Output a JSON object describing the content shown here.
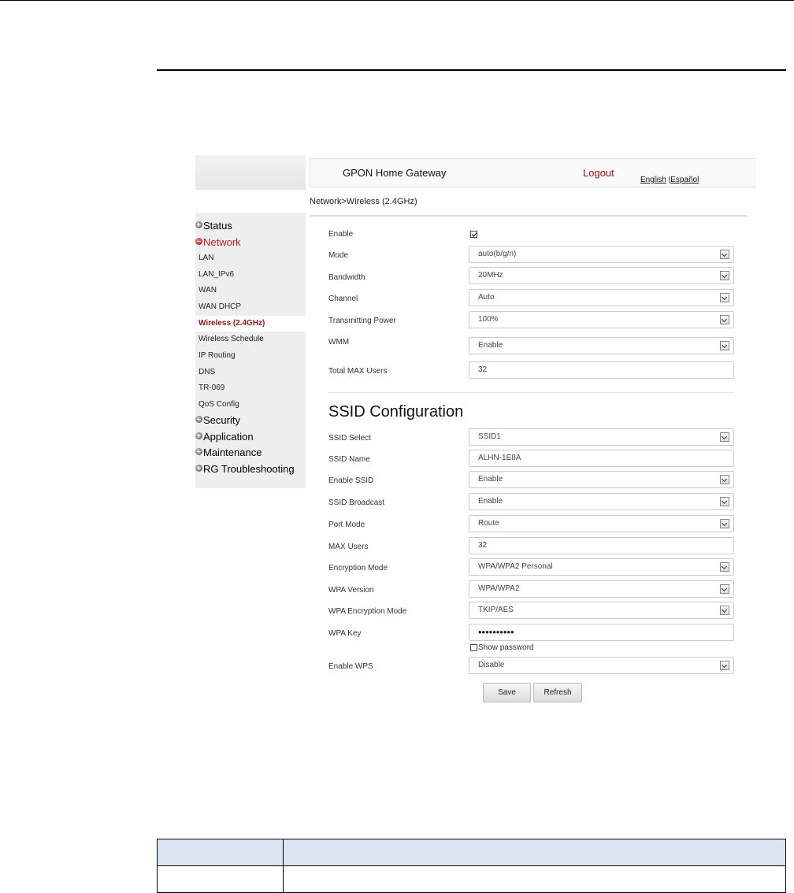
{
  "header": {
    "title": "GPON Home Gateway",
    "logout": "Logout",
    "lang_english": "English",
    "lang_separator": "|",
    "lang_spanish": "Español"
  },
  "breadcrumb": "Network>Wireless (2.4GHz)",
  "menu": {
    "groups": [
      "Status",
      "Network",
      "Security",
      "Application",
      "Maintenance",
      "RG Troubleshooting"
    ],
    "network_items": [
      "LAN",
      "LAN_IPv6",
      "WAN",
      "WAN DHCP",
      "Wireless (2.4GHz)",
      "Wireless Schedule",
      "IP Routing",
      "DNS",
      "TR-069",
      "QoS Config"
    ]
  },
  "wireless": {
    "enable_label": "Enable",
    "enable_checked": true,
    "mode_label": "Mode",
    "mode_value": "auto(b/g/n)",
    "bandwidth_label": "Bandwidth",
    "bandwidth_value": "20MHz",
    "channel_label": "Channel",
    "channel_value": "Auto",
    "power_label": "Transmitting Power",
    "power_value": "100%",
    "wmm_label": "WMM",
    "wmm_value": "Enable",
    "max_users_label": "Total MAX Users",
    "max_users_value": "32"
  },
  "ssid": {
    "section_title": "SSID Configuration",
    "select_label": "SSID Select",
    "select_value": "SSID1",
    "name_label": "SSID Name",
    "name_value": "ALHN-1E8A",
    "enable_label": "Enable SSID",
    "enable_value": "Enable",
    "broadcast_label": "SSID Broadcast",
    "broadcast_value": "Enable",
    "port_mode_label": "Port Mode",
    "port_mode_value": "Route",
    "max_users_label": "MAX Users",
    "max_users_value": "32",
    "encryption_label": "Encryption Mode",
    "encryption_value": "WPA/WPA2 Personal",
    "wpa_version_label": "WPA Version",
    "wpa_version_value": "WPA/WPA2",
    "wpa_enc_label": "WPA Encryption Mode",
    "wpa_enc_value": "TKIP/AES",
    "wpa_key_label": "WPA Key",
    "wpa_key_value": "••••••••••",
    "show_password_label": "Show password",
    "show_password_checked": false,
    "wps_label": "Enable WPS",
    "wps_value": "Disable"
  },
  "buttons": {
    "save": "Save",
    "refresh": "Refresh"
  },
  "colors": {
    "accent_red": "#b22222",
    "selected_item": "#8b1a1a",
    "table_header": "#dbe5f1"
  }
}
